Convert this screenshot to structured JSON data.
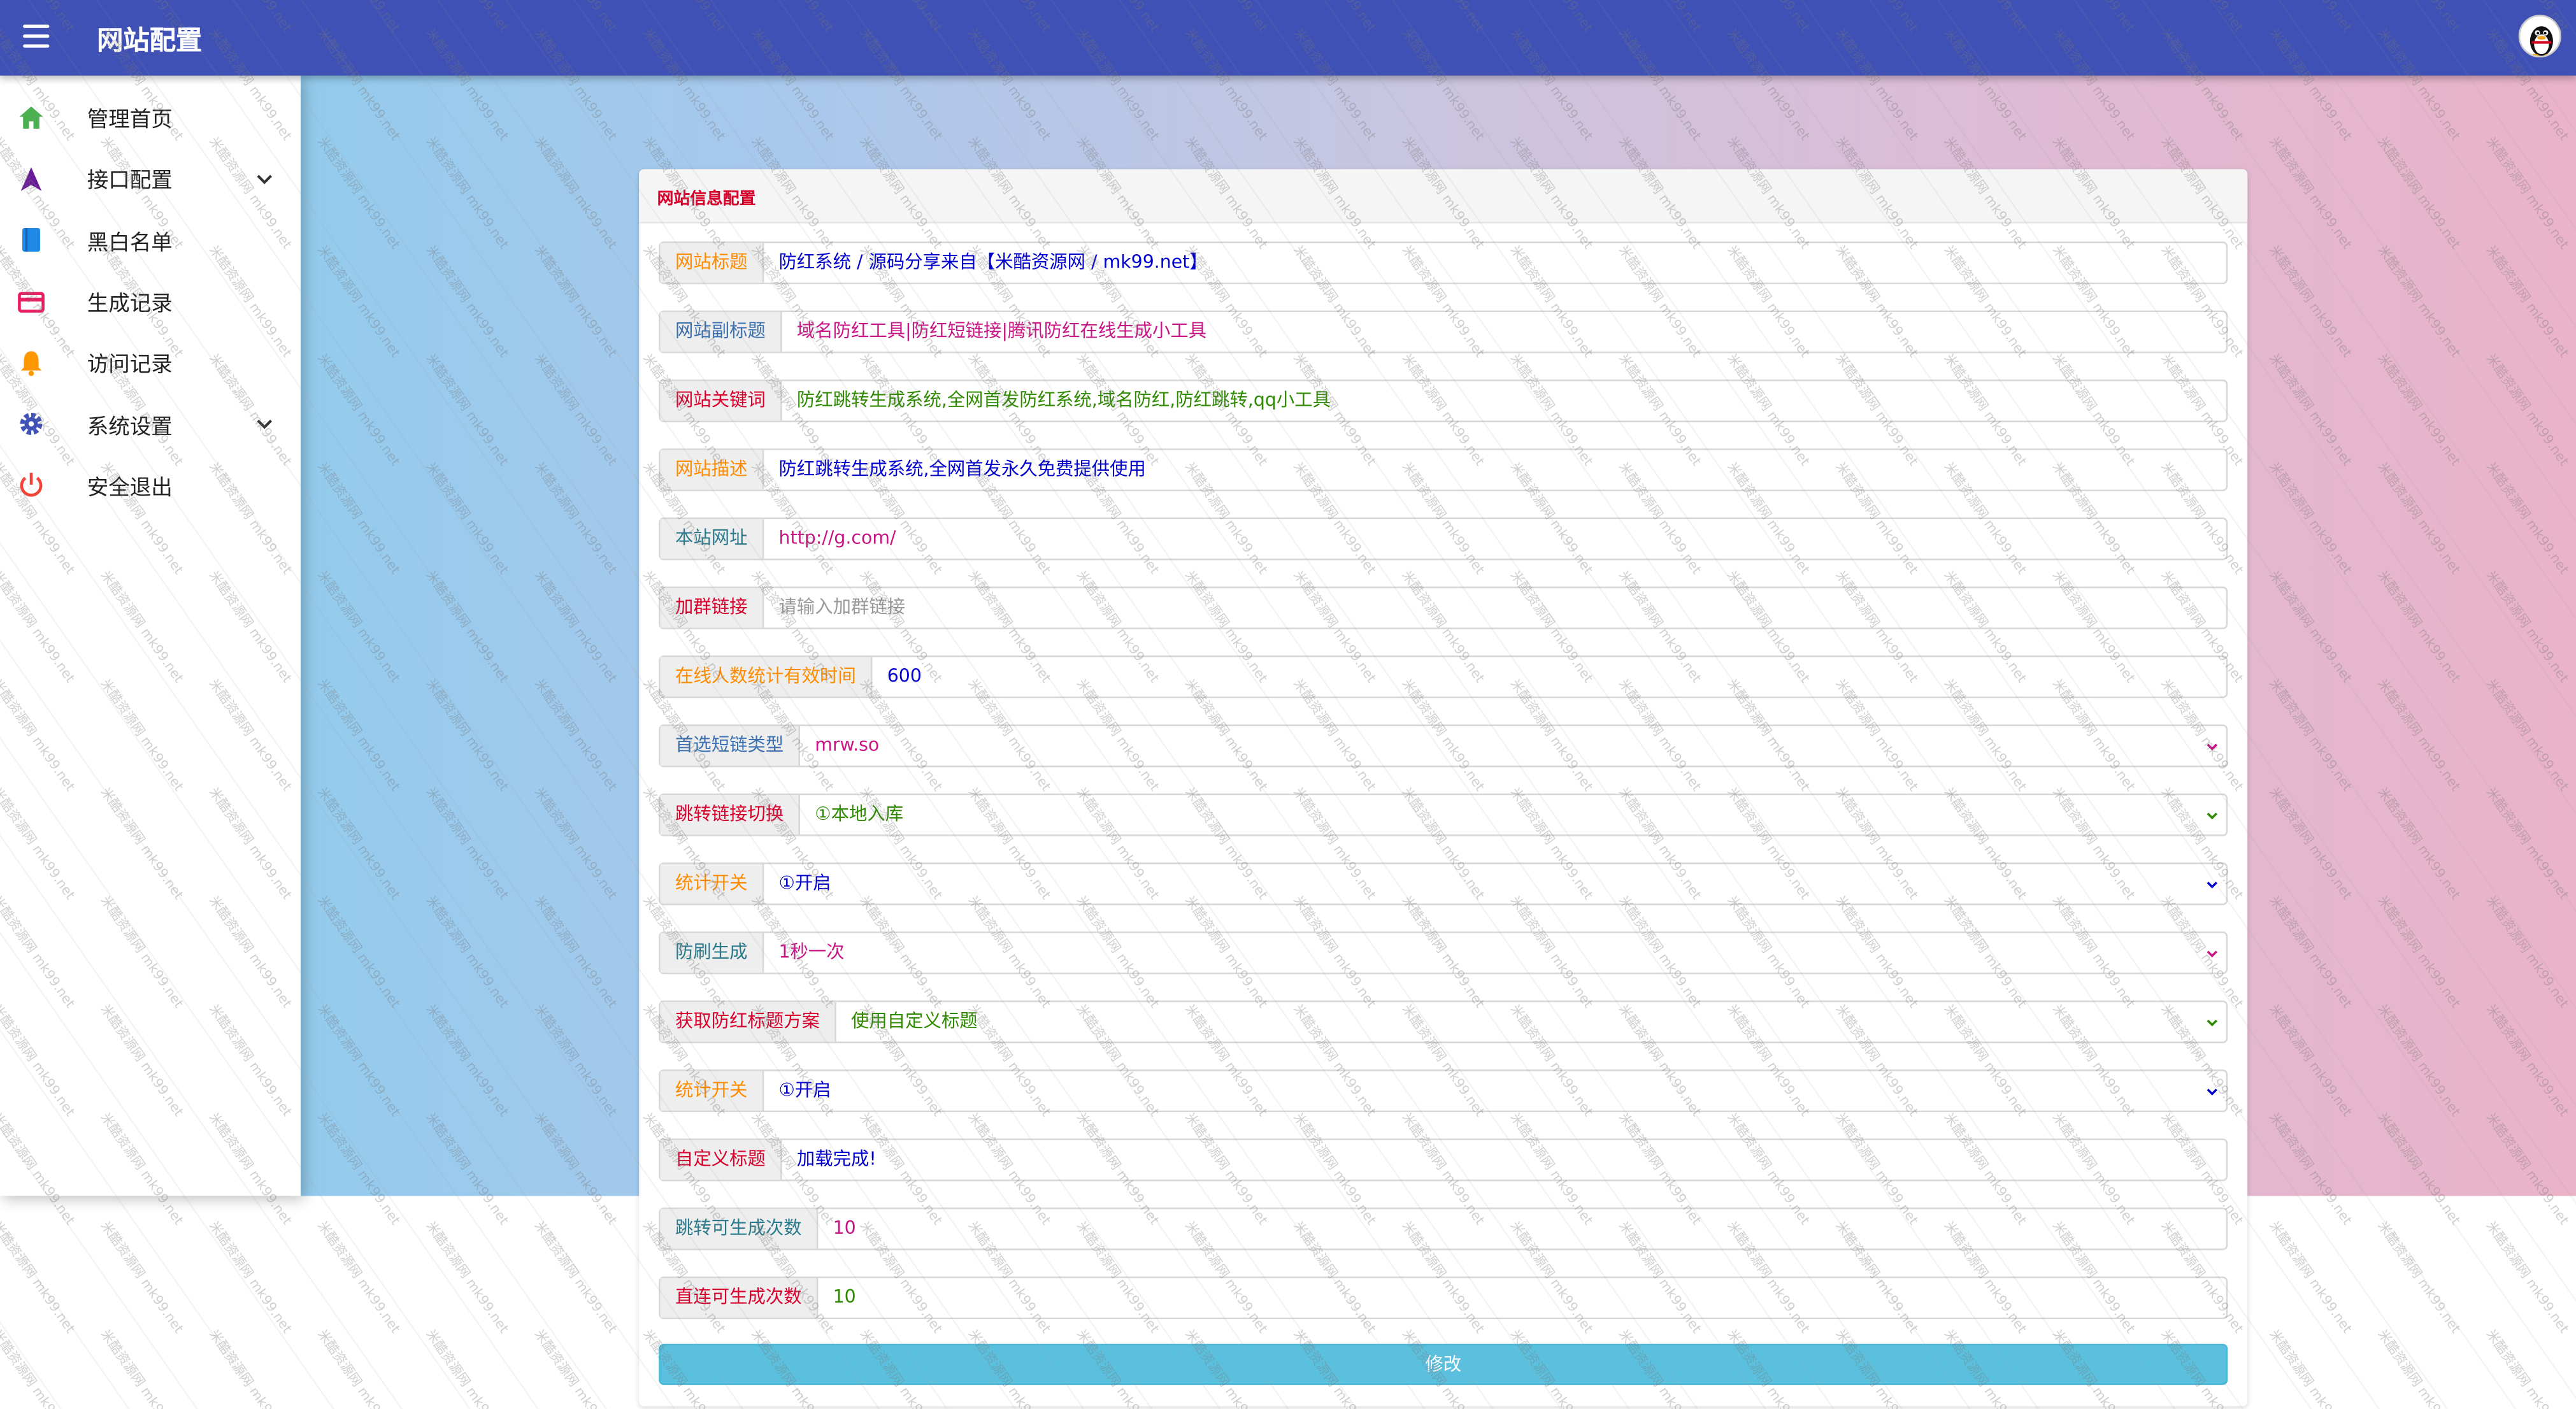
{
  "header": {
    "title": "网站配置",
    "menu_icon": "menu-icon",
    "avatar_icon": "qq-penguin-icon"
  },
  "sidebar": {
    "items": [
      {
        "label": "管理首页",
        "icon": "home-icon",
        "color": "#4caf50",
        "expandable": false
      },
      {
        "label": "接口配置",
        "icon": "navigation-icon",
        "color": "#6a1b9a",
        "expandable": true
      },
      {
        "label": "黑白名单",
        "icon": "book-icon",
        "color": "#1e88e5",
        "expandable": false
      },
      {
        "label": "生成记录",
        "icon": "card-icon",
        "color": "#e91e63",
        "expandable": false
      },
      {
        "label": "访问记录",
        "icon": "bell-icon",
        "color": "#ff9800",
        "expandable": false
      },
      {
        "label": "系统设置",
        "icon": "gear-icon",
        "color": "#3f51b5",
        "expandable": true
      },
      {
        "label": "安全退出",
        "icon": "power-icon",
        "color": "#f44336",
        "expandable": false
      }
    ]
  },
  "panel": {
    "title": "网站信息配置",
    "fields": [
      {
        "label": "网站标题",
        "label_color": "#ff8c00",
        "value": "防红系统 / 源码分享来自【米酷资源网 / mk99.net】",
        "value_color": "#0000cd",
        "type": "input"
      },
      {
        "label": "网站副标题",
        "label_color": "#3a6fb0",
        "value": "域名防红工具|防红短链接|腾讯防红在线生成小工具",
        "value_color": "#c71585",
        "type": "input"
      },
      {
        "label": "网站关键词",
        "label_color": "#d9002c",
        "value": "防红跳转生成系统,全网首发防红系统,域名防红,防红跳转,qq小工具",
        "value_color": "#2e8b00",
        "type": "input"
      },
      {
        "label": "网站描述",
        "label_color": "#ff8c00",
        "value": "防红跳转生成系统,全网首发永久免费提供使用",
        "value_color": "#0000cd",
        "type": "input"
      },
      {
        "label": "本站网址",
        "label_color": "#2a7a8c",
        "value": "http://g.com/",
        "value_color": "#c71585",
        "type": "input"
      },
      {
        "label": "加群链接",
        "label_color": "#d9002c",
        "placeholder": "请输入加群链接",
        "value_color": "#999999",
        "type": "input"
      },
      {
        "label": "在线人数统计有效时间",
        "label_color": "#ff8c00",
        "value": "600",
        "value_color": "#0000cd",
        "type": "input"
      },
      {
        "label": "首选短链类型",
        "label_color": "#3a6fb0",
        "value": "mrw.so",
        "value_color": "#c71585",
        "type": "select",
        "chevron_color": "#c71585"
      },
      {
        "label": "跳转链接切换",
        "label_color": "#d9002c",
        "value": "①本地入库",
        "value_color": "#2e8b00",
        "type": "select",
        "chevron_color": "#2e8b00"
      },
      {
        "label": "统计开关",
        "label_color": "#ff8c00",
        "value": "①开启",
        "value_color": "#0000cd",
        "type": "select",
        "chevron_color": "#0000cd"
      },
      {
        "label": "防刷生成",
        "label_color": "#2a7a8c",
        "value": "1秒一次",
        "value_color": "#c71585",
        "type": "select",
        "chevron_color": "#c71585"
      },
      {
        "label": "获取防红标题方案",
        "label_color": "#d9002c",
        "value": "使用自定义标题",
        "value_color": "#2e8b00",
        "type": "select",
        "chevron_color": "#2e8b00"
      },
      {
        "label": "统计开关",
        "label_color": "#ff8c00",
        "value": "①开启",
        "value_color": "#0000cd",
        "type": "select",
        "chevron_color": "#0000cd"
      },
      {
        "label": "自定义标题",
        "label_color": "#d9002c",
        "value": "加载完成!",
        "value_color": "#0000cd",
        "type": "input"
      },
      {
        "label": "跳转可生成次数",
        "label_color": "#2a7a8c",
        "value": "10",
        "value_color": "#c71585",
        "type": "input"
      },
      {
        "label": "直连可生成次数",
        "label_color": "#d9002c",
        "value": "10",
        "value_color": "#2e8b00",
        "type": "input"
      }
    ],
    "submit_label": "修改"
  },
  "watermark": "米酷资源网 mk99.net"
}
